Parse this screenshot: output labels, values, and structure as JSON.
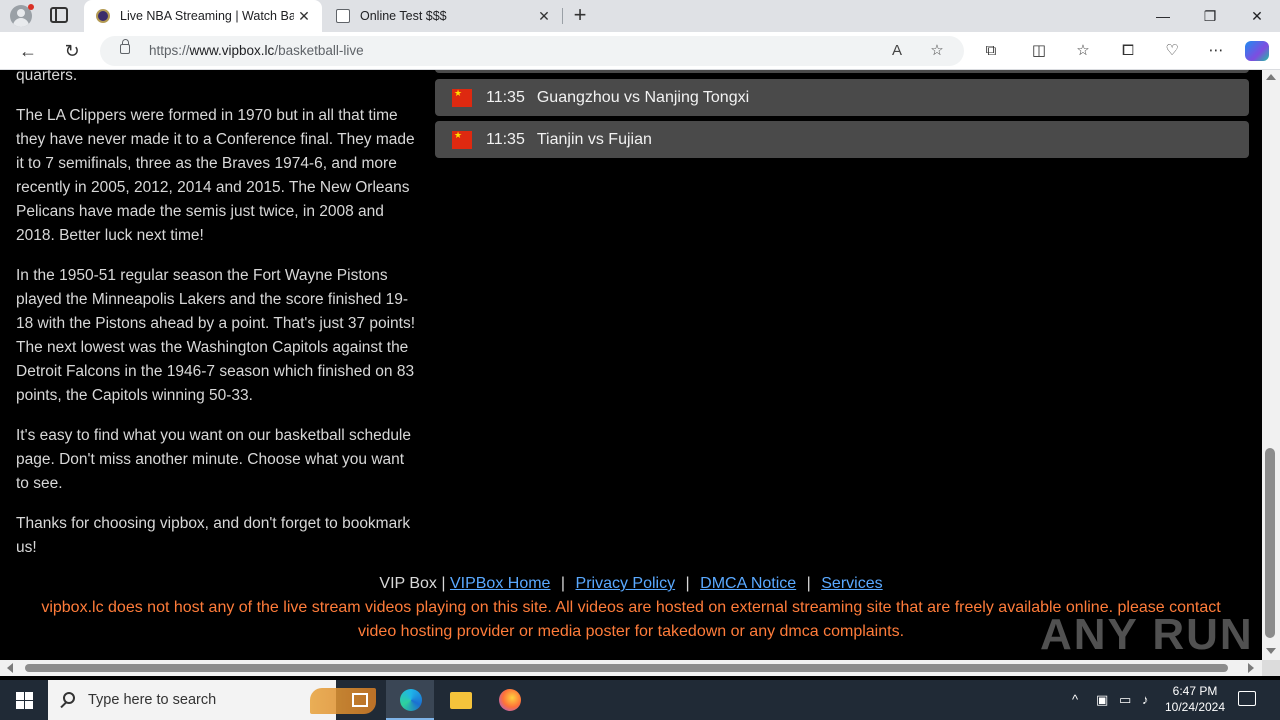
{
  "browser": {
    "tabs": [
      {
        "title": "Live NBA Streaming | Watch Basketball",
        "active": true
      },
      {
        "title": "Online Test $$$",
        "active": false
      }
    ],
    "url_prefix": "https://",
    "url_domain": "www.vipbox.lc",
    "url_path": "/basketball-live",
    "window_controls": {
      "minimize": "—",
      "restore": "❐",
      "close": "✕"
    }
  },
  "article": {
    "paragraphs": [
      "quarters.",
      "The LA Clippers were formed in 1970 but in all that time they have never made it to a Conference final. They made it to 7 semifinals, three as the Braves 1974-6, and more recently in 2005, 2012, 2014 and 2015. The New Orleans Pelicans have made the semis just twice, in 2008 and 2018. Better luck next time!",
      "In the 1950-51 regular season the Fort Wayne Pistons played the Minneapolis Lakers and the score finished 19-18 with the Pistons ahead by a point. That's just 37 points! The next lowest was the Washington Capitols against the Detroit Falcons in the 1946-7 season which finished on 83 points, the Capitols winning 50-33.",
      "It's easy to find what you want on our basketball schedule page. Don't miss another minute. Choose what you want to see.",
      "Thanks for choosing vipbox, and don't forget to bookmark us!"
    ]
  },
  "games": [
    {
      "time": "11:35",
      "match": "Guangzhou vs Nanjing Tongxi",
      "flag": "china-flag"
    },
    {
      "time": "11:35",
      "match": "Tianjin vs Fujian",
      "flag": "china-flag"
    }
  ],
  "footer": {
    "brand": "VIP Box |",
    "links": [
      "VIPBox Home",
      "Privacy Policy",
      "DMCA Notice",
      "Services"
    ],
    "separator": "|",
    "disclaimer": "vipbox.lc does not host any of the live stream videos playing on this site. All videos are hosted on external streaming site that are freely available online. please contact video hosting provider or media poster for takedown or any dmca complaints.",
    "link_color": "#5aa9ff",
    "disclaimer_color": "#ff7c3a"
  },
  "watermark": "ANY RUN",
  "taskbar": {
    "search_placeholder": "Type here to search",
    "time": "6:47 PM",
    "date": "10/24/2024"
  }
}
